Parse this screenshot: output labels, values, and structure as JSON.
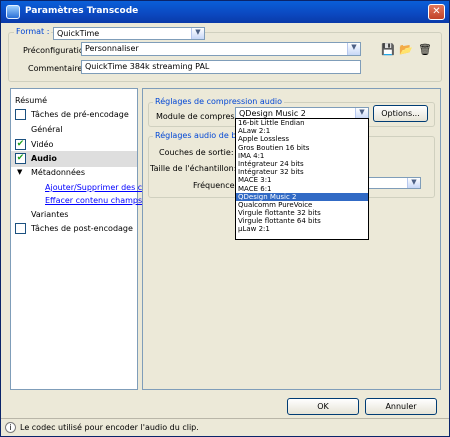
{
  "window": {
    "title": "Paramètres Transcode",
    "close": "✕"
  },
  "format": {
    "group_title": "Format :",
    "value": "QuickTime",
    "preset_label": "Préconfiguration",
    "preset_value": "Personnaliser",
    "comment_label": "Commentaire :",
    "comment_value": "QuickTime 384k streaming PAL"
  },
  "toolbar": {
    "save_icon": "floppy-disk",
    "open_icon": "folder",
    "delete_icon": "trash"
  },
  "nav": {
    "items": [
      {
        "label": "Résumé",
        "checkbox": false
      },
      {
        "label": "Tâches de pré-encodage",
        "checkbox": true,
        "checked": false
      },
      {
        "label": "Général",
        "checkbox": false
      },
      {
        "label": "Vidéo",
        "checkbox": true,
        "checked": true
      },
      {
        "label": "Audio",
        "checkbox": true,
        "checked": true,
        "selected": true
      },
      {
        "label": "Métadonnées",
        "checkbox": false,
        "expanded": true
      },
      {
        "label": "Ajouter/Supprimer des cham",
        "link": true
      },
      {
        "label": "Effacer contenu champs",
        "link": true
      },
      {
        "label": "Variantes",
        "checkbox": false
      },
      {
        "label": "Tâches de post-encodage",
        "checkbox": true,
        "checked": false
      }
    ]
  },
  "compression": {
    "group_title": "Réglages de compression audio",
    "module_label": "Module de compression:",
    "module_value": "QDesign Music 2",
    "options_button": "Options..."
  },
  "basic": {
    "group_title": "Réglages audio de base",
    "channels_label": "Couches de sortie:",
    "sample_size_label": "Taille de l'échantillon:",
    "frequency_label": "Fréquence:"
  },
  "dropdown": {
    "selected": "QDesign Music 2",
    "options": [
      "16-bit Little Endian",
      "ALaw 2:1",
      "Apple Lossless",
      "Gros Boutien 16 bits",
      "IMA 4:1",
      "Intégrateur 24 bits",
      "Intégrateur 32 bits",
      "MACE 3:1",
      "MACE 6:1",
      "QDesign Music 2",
      "Qualcomm PureVoice",
      "Virgule flottante 32 bits",
      "Virgule flottante 64 bits",
      "µLaw 2:1"
    ]
  },
  "buttons": {
    "ok": "OK",
    "cancel": "Annuler"
  },
  "status": {
    "text": "Le codec utilisé pour encoder l'audio du clip."
  }
}
